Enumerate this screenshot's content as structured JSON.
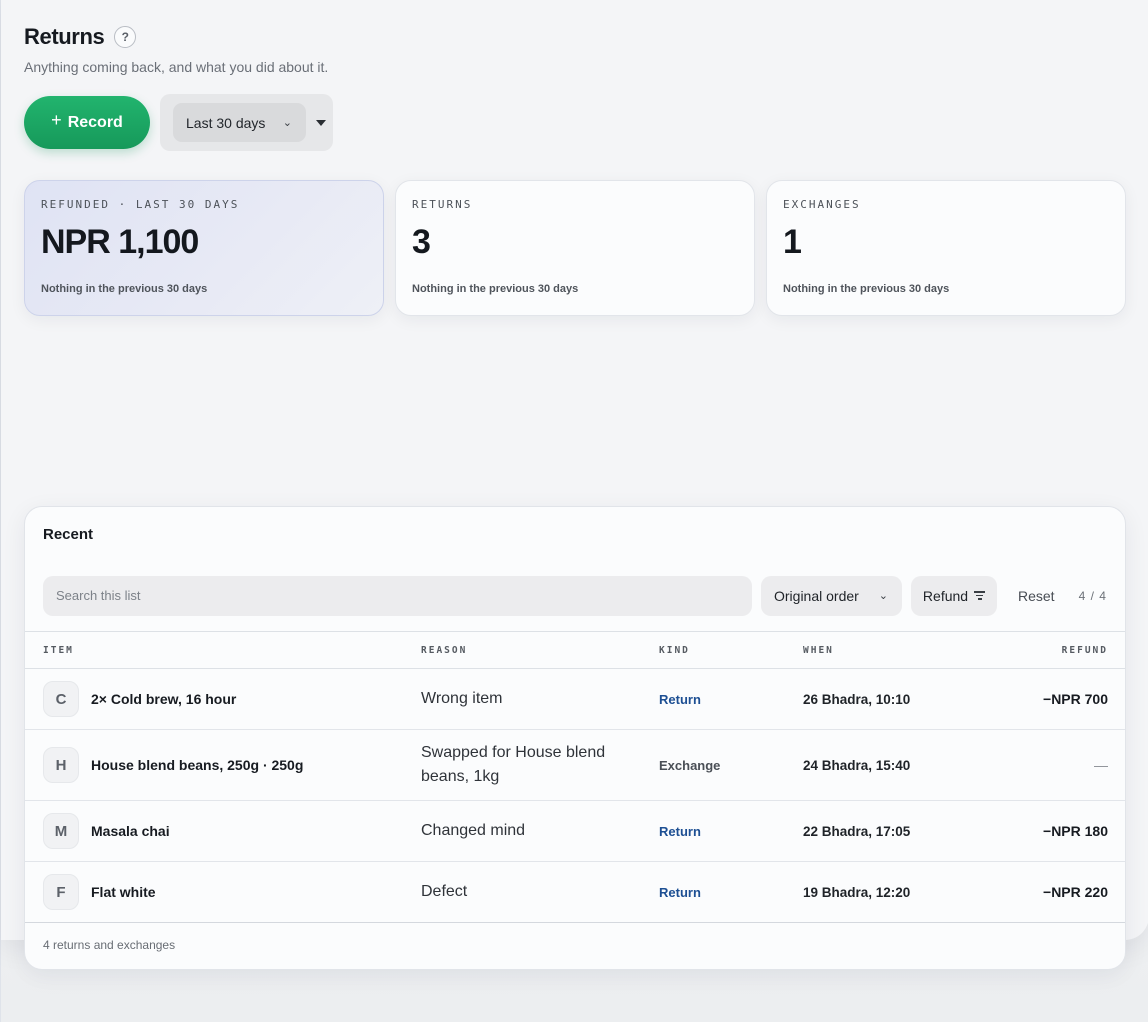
{
  "header": {
    "title": "Returns",
    "help_icon": "?",
    "subtitle": "Anything coming back, and what you did about it."
  },
  "actions": {
    "record_plus": "+",
    "record_label": "Record",
    "range_value": "Last 30 days"
  },
  "stats": [
    {
      "label": "REFUNDED · LAST 30 DAYS",
      "value": "NPR 1,100",
      "note": "Nothing in the previous 30 days"
    },
    {
      "label": "RETURNS",
      "value": "3",
      "note": "Nothing in the previous 30 days"
    },
    {
      "label": "EXCHANGES",
      "value": "1",
      "note": "Nothing in the previous 30 days"
    }
  ],
  "recent": {
    "title": "Recent",
    "search_placeholder": "Search this list",
    "order_value": "Original order",
    "refund_filter_label": "Refund",
    "reset_label": "Reset",
    "count": "4 / 4",
    "columns": {
      "item": "ITEM",
      "reason": "REASON",
      "kind": "KIND",
      "when": "WHEN",
      "refund": "REFUND"
    },
    "rows": [
      {
        "initial": "C",
        "item": "2× Cold brew, 16 hour",
        "reason": "Wrong item",
        "kind": "Return",
        "when": "26 Bhadra, 10:10",
        "refund": "−NPR 700"
      },
      {
        "initial": "H",
        "item": "House blend beans, 250g · 250g",
        "reason": "Swapped for House blend beans, 1kg",
        "kind": "Exchange",
        "when": "24 Bhadra, 15:40",
        "refund": "—"
      },
      {
        "initial": "M",
        "item": "Masala chai",
        "reason": "Changed mind",
        "kind": "Return",
        "when": "22 Bhadra, 17:05",
        "refund": "−NPR 180"
      },
      {
        "initial": "F",
        "item": "Flat white",
        "reason": "Defect",
        "kind": "Return",
        "when": "19 Bhadra, 12:20",
        "refund": "−NPR 220"
      }
    ],
    "footer": "4 returns and exchanges"
  },
  "colors": {
    "primary_green": "#1aa564",
    "return_blue": "#1d4f93",
    "accent_card": "#e3e6f4"
  }
}
